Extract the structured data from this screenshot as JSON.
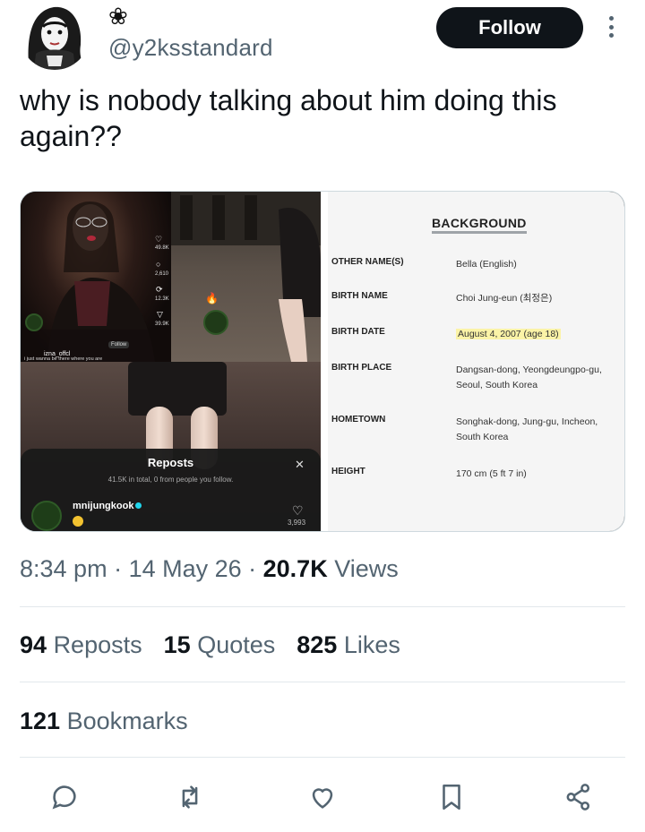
{
  "author": {
    "display_name": "❀",
    "handle": "@y2ksstandard"
  },
  "header": {
    "follow_label": "Follow"
  },
  "tweet": {
    "text": "why is nobody talking about him doing this again??"
  },
  "media": {
    "tiktok": {
      "like_count": "49.8K",
      "comment_count": "2,610",
      "share_count": "12.3K",
      "save_count": "39.9K",
      "username_small": "izna_offcl",
      "follow_small": "Follow",
      "caption": "i just wanna be there where you are",
      "username": "izna_offcl",
      "follow_partial": "Follow",
      "badge": "izna"
    },
    "reposts_sheet": {
      "title": "Reposts",
      "subtitle": "41.5K in total, 0 from people you follow.",
      "user": "mnijungkook",
      "count": "3,993"
    },
    "background_card": {
      "title": "BACKGROUND",
      "rows": [
        {
          "label": "OTHER NAME(S)",
          "value": "Bella (English)"
        },
        {
          "label": "BIRTH NAME",
          "value": "Choi Jung-eun (최정은)"
        },
        {
          "label": "BIRTH DATE",
          "value": "August 4, 2007 (age 18)"
        },
        {
          "label": "BIRTH PLACE",
          "value": "Dangsan-dong, Yeongdeungpo-gu, Seoul, South Korea"
        },
        {
          "label": "HOMETOWN",
          "value": "Songhak-dong, Jung-gu, Incheon, South Korea"
        },
        {
          "label": "HEIGHT",
          "value": "170 cm (5 ft 7 in)"
        }
      ]
    }
  },
  "meta": {
    "time": "8:34 pm",
    "sep1": " · ",
    "date": "14 May 26",
    "sep2": " · ",
    "views_count": "20.7K",
    "views_label": " Views"
  },
  "stats": {
    "reposts_count": "94",
    "reposts_label": "Reposts",
    "quotes_count": "15",
    "quotes_label": "Quotes",
    "likes_count": "825",
    "likes_label": "Likes",
    "bookmarks_count": "121",
    "bookmarks_label": "Bookmarks"
  },
  "actions": [
    "reply-icon",
    "repost-icon",
    "like-icon",
    "bookmark-icon",
    "share-icon"
  ],
  "colors": {
    "text_primary": "#0f1419",
    "text_secondary": "#536471",
    "follow_bg": "#0f1419",
    "highlight": "#fbf3a7"
  }
}
